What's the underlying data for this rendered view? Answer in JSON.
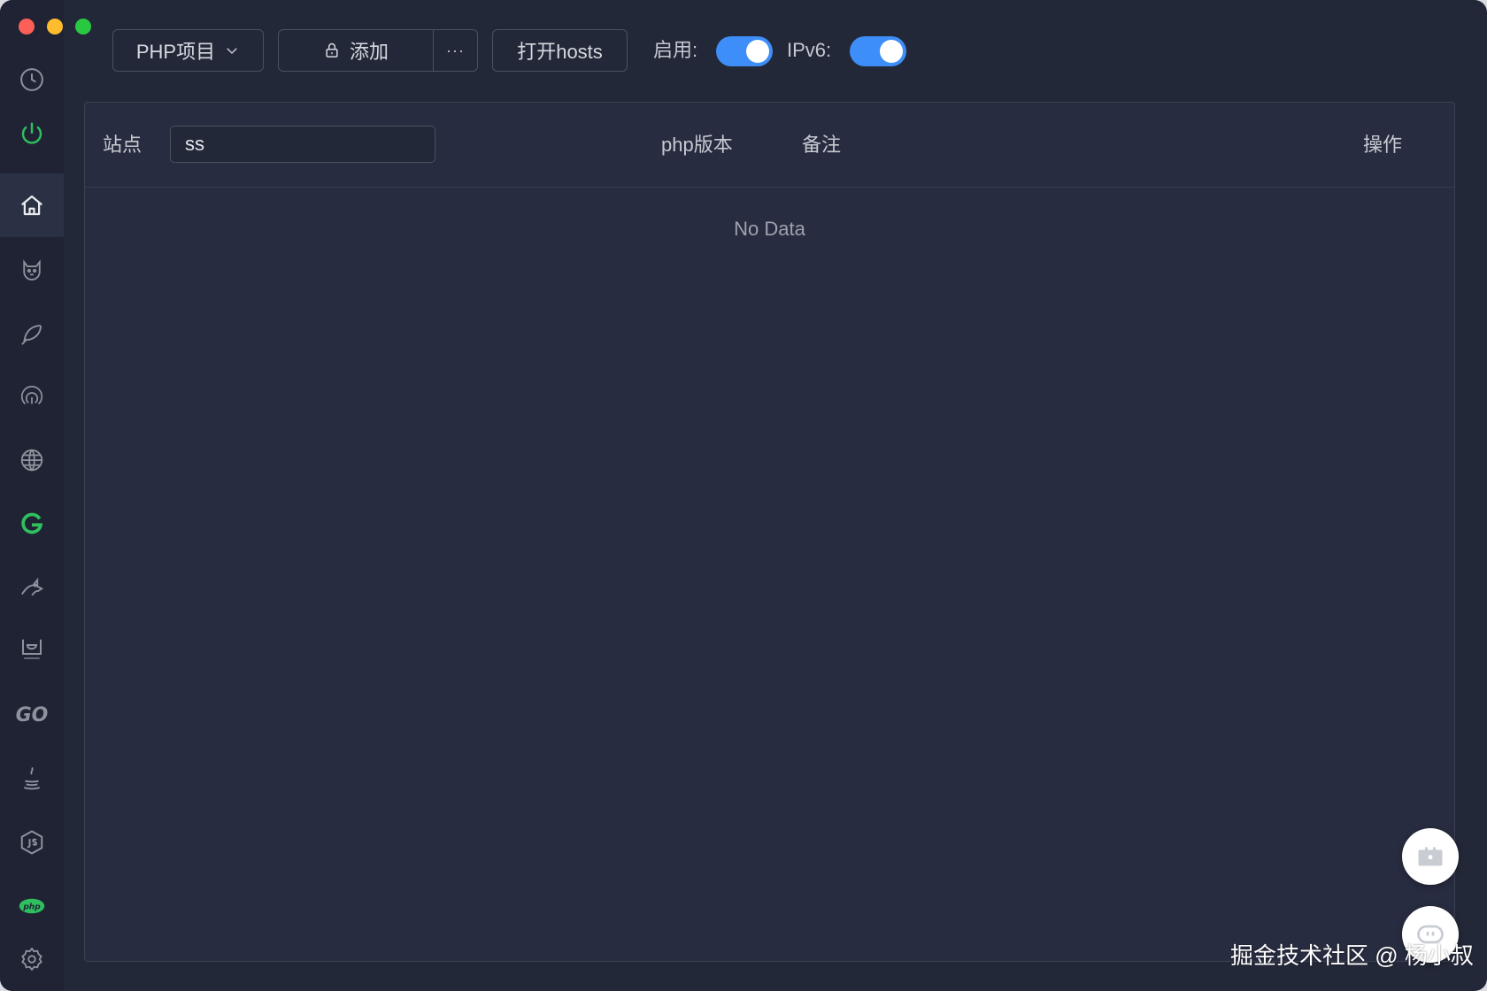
{
  "toolbar": {
    "project_select": "PHP项目",
    "add_label": "添加",
    "more_label": "···",
    "open_hosts_label": "打开hosts",
    "enable_label": "启用:",
    "enable_on": true,
    "ipv6_label": "IPv6:",
    "ipv6_on": true
  },
  "table": {
    "col_site": "站点",
    "search_value": "ss",
    "col_php": "php版本",
    "col_note": "备注",
    "col_ops": "操作",
    "empty_text": "No Data"
  },
  "sidebar": {
    "items": [
      {
        "icon": "clock-icon"
      },
      {
        "icon": "power-icon",
        "color": "#2fbf5f"
      },
      {
        "icon": "home-icon",
        "active": true
      },
      {
        "icon": "cat-icon"
      },
      {
        "icon": "feather-icon"
      },
      {
        "icon": "fingerprint-icon"
      },
      {
        "icon": "globe-icon"
      },
      {
        "icon": "g-icon",
        "color": "#2fbf5f"
      },
      {
        "icon": "tomcat-icon"
      },
      {
        "icon": "erlang-icon"
      },
      {
        "icon": "go-icon",
        "text": "GO"
      },
      {
        "icon": "java-icon"
      },
      {
        "icon": "nodejs-icon"
      },
      {
        "icon": "php-icon",
        "text": "php",
        "color": "#2fbf5f"
      },
      {
        "icon": "gear-icon"
      }
    ]
  },
  "colors": {
    "accent": "#3d8ef8",
    "background": "#232839",
    "panel": "#282c40",
    "sidebar": "#1f2333"
  },
  "watermark": "掘金技术社区 @ 杨小叔"
}
